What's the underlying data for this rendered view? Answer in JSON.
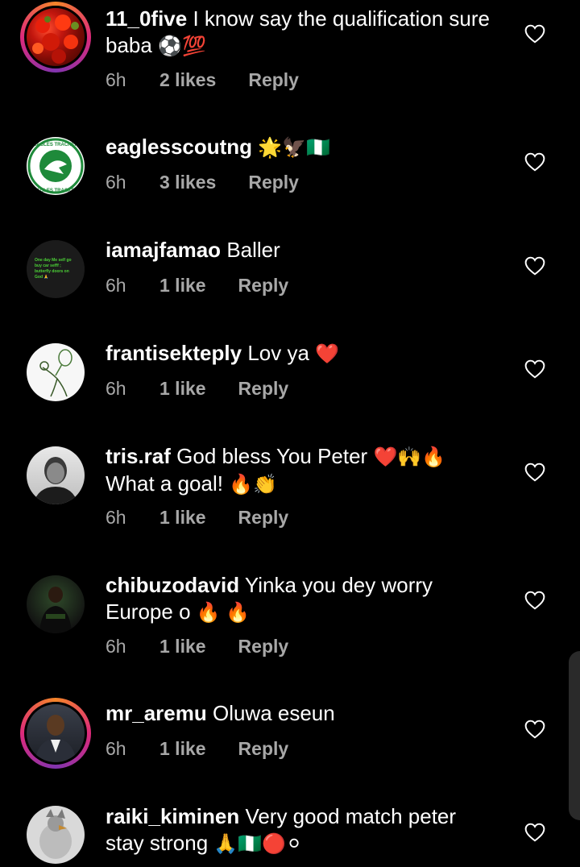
{
  "comments": [
    {
      "username": "11_0five",
      "text": "I know say the qualification sure baba",
      "emoji": "⚽💯",
      "time": "6h",
      "likes": "2 likes",
      "reply": "Reply"
    },
    {
      "username": "eaglesscoutng",
      "text": "",
      "emoji": "🌟🦅🇳🇬",
      "time": "6h",
      "likes": "3 likes",
      "reply": "Reply",
      "avatar_text": [
        "EAGLES TRACKER",
        "EAGLES TRACKER"
      ]
    },
    {
      "username": "iamajfamao",
      "text": "Baller",
      "emoji": "",
      "time": "6h",
      "likes": "1 like",
      "reply": "Reply",
      "avatar_text": "One day Me self go buy car sefff ; butterfly doors on God 🙏"
    },
    {
      "username": "frantisekteply",
      "text": "Lov ya",
      "emoji": "❤️",
      "time": "6h",
      "likes": "1 like",
      "reply": "Reply"
    },
    {
      "username": "tris.raf",
      "text": "God bless You Peter",
      "emoji": "❤️🙌🔥",
      "text2": "What a goal!",
      "emoji2": "🔥👏",
      "time": "6h",
      "likes": "1 like",
      "reply": "Reply"
    },
    {
      "username": "chibuzodavid",
      "text": "Yinka you dey worry Europe o",
      "emoji": "🔥 🔥",
      "time": "6h",
      "likes": "1 like",
      "reply": "Reply"
    },
    {
      "username": "mr_aremu",
      "text": "Oluwa eseun",
      "emoji": "",
      "time": "6h",
      "likes": "1 like",
      "reply": "Reply"
    },
    {
      "username": "raiki_kiminen",
      "text": "Very good match peter stay strong",
      "emoji": "🙏🇳🇬🔴⚪",
      "time": "",
      "likes": "",
      "reply": ""
    }
  ],
  "colors": {
    "background": "#000000",
    "text": "#ffffff",
    "meta": "#a8a8a8",
    "story_ring": "#dd2a7b"
  },
  "icons": {
    "like": "heart-outline-icon"
  }
}
